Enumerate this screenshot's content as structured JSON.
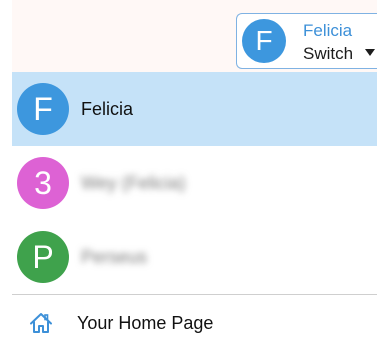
{
  "switcher": {
    "avatar_letter": "F",
    "name": "Felicia",
    "action_label": "Switch",
    "caret_icon": "caret-down-icon"
  },
  "accounts": [
    {
      "avatar_letter": "F",
      "name": "Felicia",
      "avatar_color": "#3d97de",
      "selected": true
    },
    {
      "avatar_letter": "3",
      "name": "Wey (Felicia)",
      "avatar_color": "#dd62d4",
      "selected": false
    },
    {
      "avatar_letter": "P",
      "name": "Perseus",
      "avatar_color": "#3fa24c",
      "selected": false
    }
  ],
  "home_link": {
    "icon": "home-icon",
    "label": "Your Home Page"
  },
  "colors": {
    "accent": "#3d90d8",
    "selected_row": "#c5e2f8",
    "top_strip": "#fff8f6"
  }
}
